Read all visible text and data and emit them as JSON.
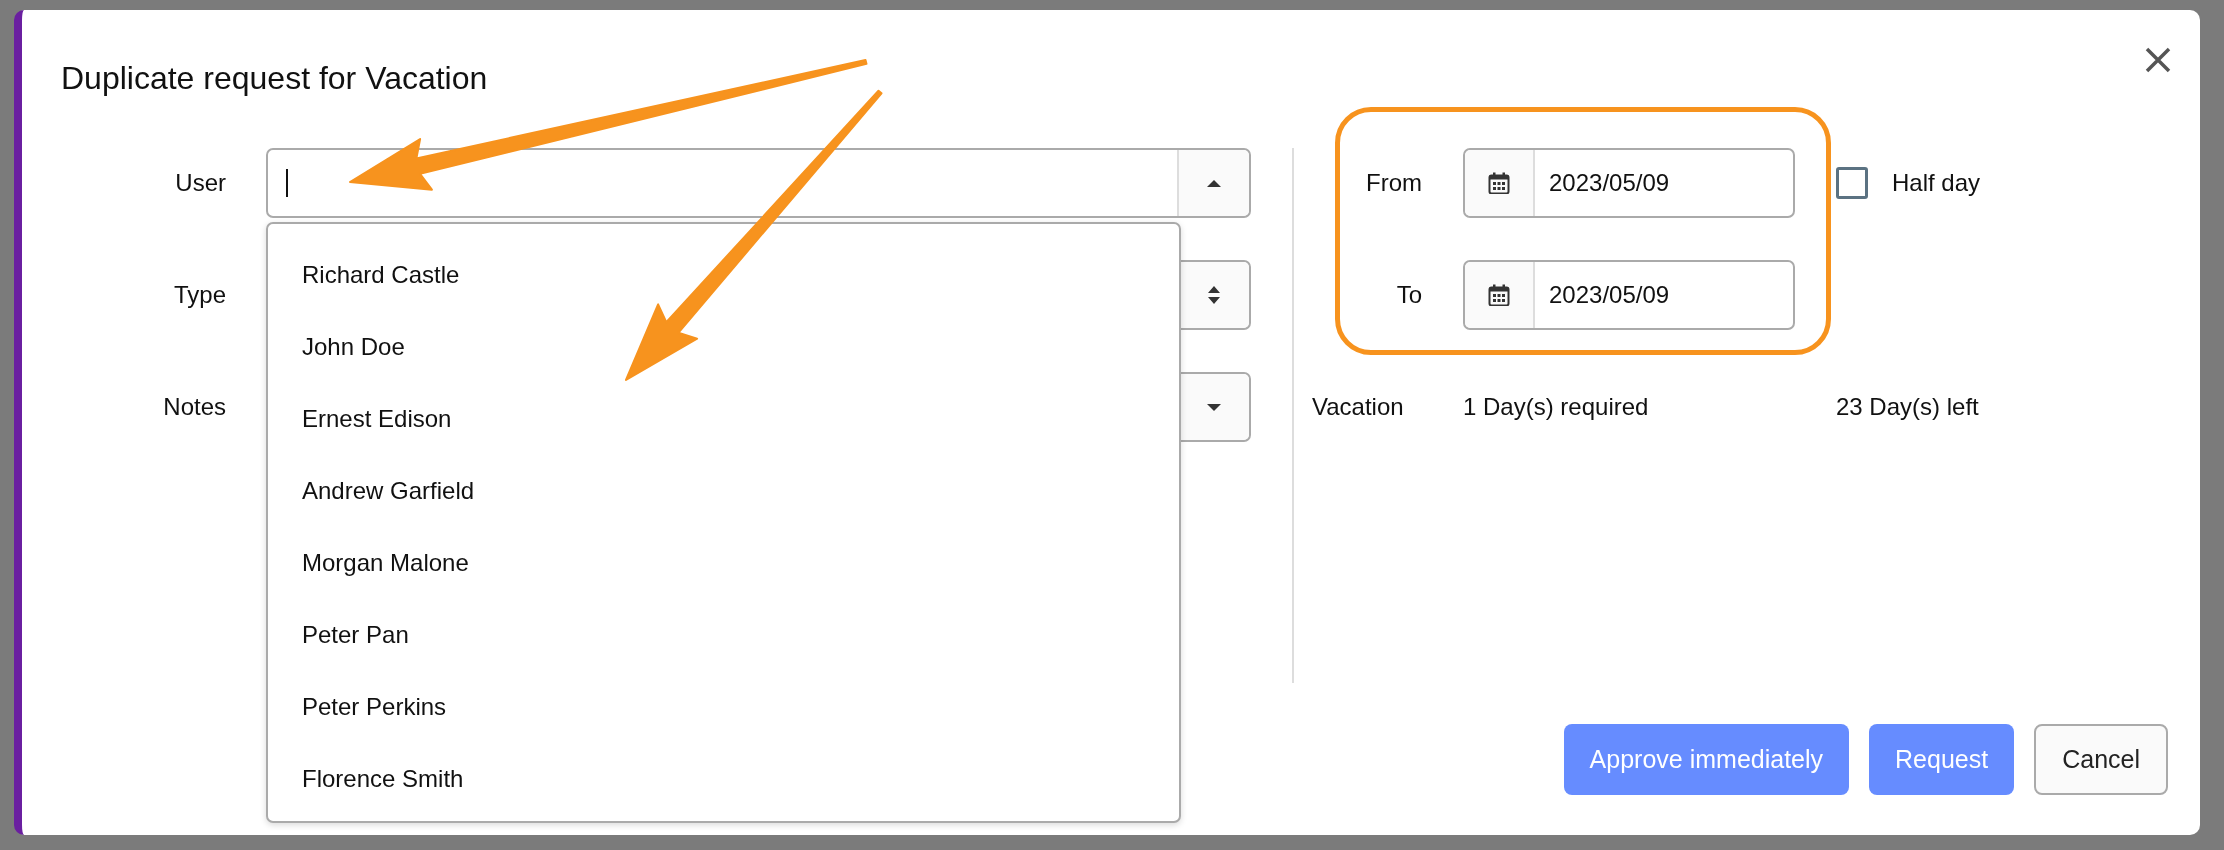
{
  "dialog": {
    "title": "Duplicate request for Vacation"
  },
  "form": {
    "user": {
      "label": "User",
      "expanded": true,
      "options": [
        "Richard Castle",
        "John Doe",
        "Ernest Edison",
        "Andrew Garfield",
        "Morgan Malone",
        "Peter Pan",
        "Peter Perkins",
        "Florence Smith"
      ]
    },
    "type": {
      "label": "Type"
    },
    "notes": {
      "label": "Notes"
    }
  },
  "dates": [
    {
      "label": "From",
      "value": "2023/05/09"
    },
    {
      "label": "To",
      "value": "2023/05/09"
    }
  ],
  "half_day": {
    "label": "Half day",
    "checked": false
  },
  "balance": {
    "type": "Vacation",
    "required": "1 Day(s) required",
    "left": "23 Day(s) left"
  },
  "buttons": [
    {
      "label": "Approve immediately",
      "kind": "primary"
    },
    {
      "label": "Request",
      "kind": "primary"
    },
    {
      "label": "Cancel",
      "kind": "secondary"
    }
  ]
}
